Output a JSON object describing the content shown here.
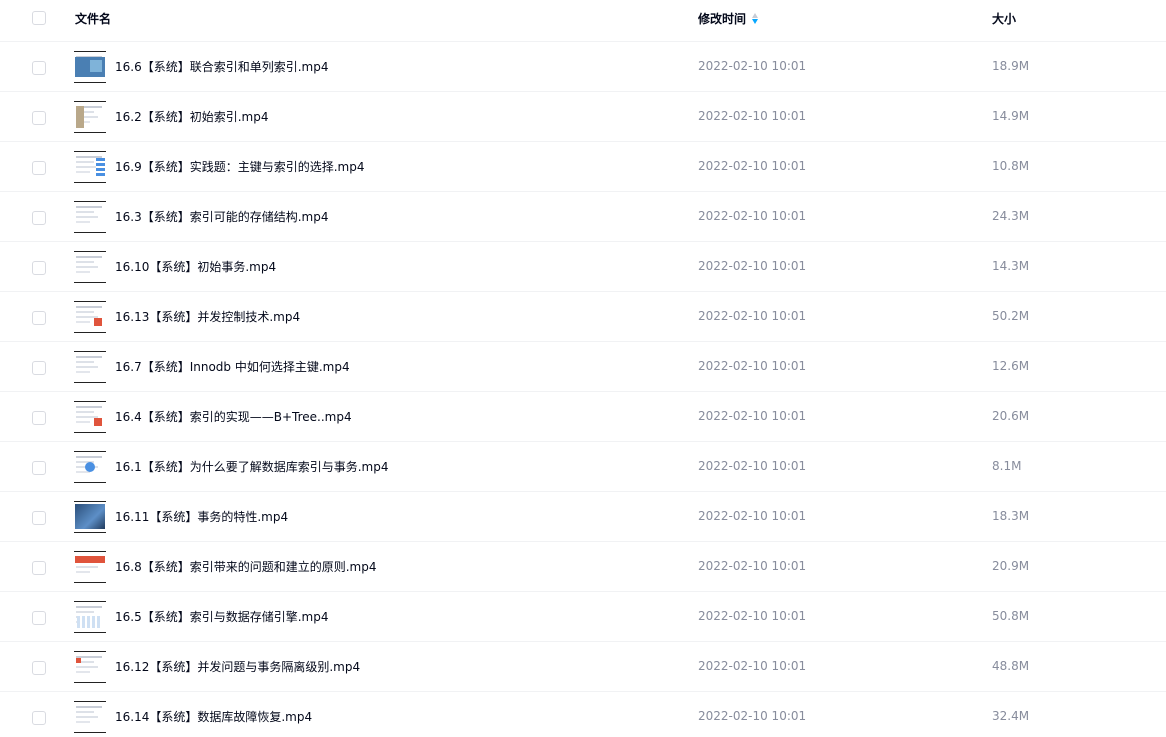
{
  "header": {
    "name_label": "文件名",
    "time_label": "修改时间",
    "size_label": "大小",
    "sort": {
      "column": "time",
      "direction": "descending",
      "active_color": "#06a7ff"
    }
  },
  "files": [
    {
      "name": "16.6【系统】联合索引和单列索引.mp4",
      "time": "2022-02-10 10:01",
      "size": "18.9M",
      "thumbnail": "blue-slide"
    },
    {
      "name": "16.2【系统】初始索引.mp4",
      "time": "2022-02-10 10:01",
      "size": "14.9M",
      "thumbnail": "tan-slide"
    },
    {
      "name": "16.9【系统】实践题：主键与索引的选择.mp4",
      "time": "2022-02-10 10:01",
      "size": "10.8M",
      "thumbnail": "stack-slide"
    },
    {
      "name": "16.3【系统】索引可能的存储结构.mp4",
      "time": "2022-02-10 10:01",
      "size": "24.3M",
      "thumbnail": "text-slide"
    },
    {
      "name": "16.10【系统】初始事务.mp4",
      "time": "2022-02-10 10:01",
      "size": "14.3M",
      "thumbnail": "text-slide"
    },
    {
      "name": "16.13【系统】并发控制技术.mp4",
      "time": "2022-02-10 10:01",
      "size": "50.2M",
      "thumbnail": "mixed-slide"
    },
    {
      "name": "16.7【系统】Innodb 中如何选择主键.mp4",
      "time": "2022-02-10 10:01",
      "size": "12.6M",
      "thumbnail": "text-slide"
    },
    {
      "name": "16.4【系统】索引的实现——B+Tree..mp4",
      "time": "2022-02-10 10:01",
      "size": "20.6M",
      "thumbnail": "mixed-slide"
    },
    {
      "name": "16.1【系统】为什么要了解数据库索引与事务.mp4",
      "time": "2022-02-10 10:01",
      "size": "8.1M",
      "thumbnail": "diagram-slide"
    },
    {
      "name": "16.11【系统】事务的特性.mp4",
      "time": "2022-02-10 10:01",
      "size": "18.3M",
      "thumbnail": "photo-slide"
    },
    {
      "name": "16.8【系统】索引带来的问题和建立的原则.mp4",
      "time": "2022-02-10 10:01",
      "size": "20.9M",
      "thumbnail": "red-slide"
    },
    {
      "name": "16.5【系统】索引与数据存储引擎.mp4",
      "time": "2022-02-10 10:01",
      "size": "50.8M",
      "thumbnail": "table-slide"
    },
    {
      "name": "16.12【系统】并发问题与事务隔离级别.mp4",
      "time": "2022-02-10 10:01",
      "size": "48.8M",
      "thumbnail": "redsmall-slide"
    },
    {
      "name": "16.14【系统】数据库故障恢复.mp4",
      "time": "2022-02-10 10:01",
      "size": "32.4M",
      "thumbnail": "text-slide"
    }
  ]
}
